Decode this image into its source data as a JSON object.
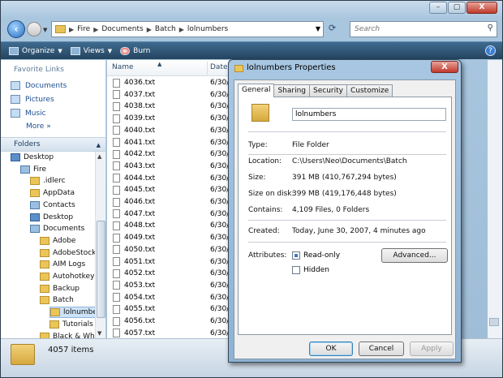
{
  "explorer": {
    "window_buttons": {
      "minimize": "–",
      "maximize": "▢",
      "close": "X"
    },
    "breadcrumbs": [
      "Fire",
      "Documents",
      "Batch",
      "lolnumbers"
    ],
    "search_placeholder": "Search",
    "toolbar": {
      "organize": "Organize",
      "views": "Views",
      "burn": "Burn"
    },
    "favorite_links_header": "Favorite Links",
    "favorites": [
      "Documents",
      "Pictures",
      "Music"
    ],
    "more_label": "More",
    "folders_header": "Folders",
    "tree": [
      {
        "label": "Desktop",
        "depth": 0,
        "icon": "desktop-icon"
      },
      {
        "label": "Fire",
        "depth": 1,
        "icon": "user-folder-icon"
      },
      {
        "label": ".idlerc",
        "depth": 2,
        "icon": "folder-icon"
      },
      {
        "label": "AppData",
        "depth": 2,
        "icon": "folder-icon"
      },
      {
        "label": "Contacts",
        "depth": 2,
        "icon": "contacts-icon"
      },
      {
        "label": "Desktop",
        "depth": 2,
        "icon": "desktop-icon"
      },
      {
        "label": "Documents",
        "depth": 2,
        "icon": "documents-icon"
      },
      {
        "label": "Adobe",
        "depth": 3,
        "icon": "folder-icon"
      },
      {
        "label": "AdobeStockPh",
        "depth": 3,
        "icon": "folder-icon"
      },
      {
        "label": "AIM Logs",
        "depth": 3,
        "icon": "folder-icon"
      },
      {
        "label": "Autohotkey",
        "depth": 3,
        "icon": "folder-icon"
      },
      {
        "label": "Backup",
        "depth": 3,
        "icon": "folder-icon"
      },
      {
        "label": "Batch",
        "depth": 3,
        "icon": "folder-icon"
      },
      {
        "label": "lolnumbers",
        "depth": 4,
        "icon": "folder-icon",
        "selected": true
      },
      {
        "label": "Tutorials",
        "depth": 4,
        "icon": "folder-icon"
      },
      {
        "label": "Black & White",
        "depth": 3,
        "icon": "folder-icon"
      }
    ],
    "columns": {
      "name": "Name",
      "date": "Date"
    },
    "files": [
      {
        "name": "4036.txt",
        "date": "6/30/"
      },
      {
        "name": "4037.txt",
        "date": "6/30/"
      },
      {
        "name": "4038.txt",
        "date": "6/30/"
      },
      {
        "name": "4039.txt",
        "date": "6/30/"
      },
      {
        "name": "4040.txt",
        "date": "6/30/"
      },
      {
        "name": "4041.txt",
        "date": "6/30/"
      },
      {
        "name": "4042.txt",
        "date": "6/30/"
      },
      {
        "name": "4043.txt",
        "date": "6/30/"
      },
      {
        "name": "4044.txt",
        "date": "6/30/"
      },
      {
        "name": "4045.txt",
        "date": "6/30/"
      },
      {
        "name": "4046.txt",
        "date": "6/30/"
      },
      {
        "name": "4047.txt",
        "date": "6/30/"
      },
      {
        "name": "4048.txt",
        "date": "6/30/"
      },
      {
        "name": "4049.txt",
        "date": "6/30/"
      },
      {
        "name": "4050.txt",
        "date": "6/30/"
      },
      {
        "name": "4051.txt",
        "date": "6/30/"
      },
      {
        "name": "4052.txt",
        "date": "6/30/"
      },
      {
        "name": "4053.txt",
        "date": "6/30/"
      },
      {
        "name": "4054.txt",
        "date": "6/30/"
      },
      {
        "name": "4055.txt",
        "date": "6/30/"
      },
      {
        "name": "4056.txt",
        "date": "6/30/"
      },
      {
        "name": "4057.txt",
        "date": "6/30/"
      }
    ],
    "item_count": "4057 items"
  },
  "dialog": {
    "title": "lolnumbers Properties",
    "close_label": "X",
    "tabs": [
      "General",
      "Sharing",
      "Security",
      "Customize"
    ],
    "active_tab": "General",
    "folder_name": "lolnumbers",
    "properties": [
      {
        "label": "Type:",
        "value": "File Folder"
      },
      {
        "label": "Location:",
        "value": "C:\\Users\\Neo\\Documents\\Batch"
      },
      {
        "label": "Size:",
        "value": "391 MB (410,767,294 bytes)"
      },
      {
        "label": "Size on disk:",
        "value": "399 MB (419,176,448 bytes)"
      },
      {
        "label": "Contains:",
        "value": "4,109 Files, 0 Folders"
      }
    ],
    "created_label": "Created:",
    "created_value": "Today, June 30, 2007, 4 minutes ago",
    "attributes_label": "Attributes:",
    "readonly_label": "Read-only",
    "hidden_label": "Hidden",
    "advanced_label": "Advanced...",
    "ok_label": "OK",
    "cancel_label": "Cancel",
    "apply_label": "Apply"
  }
}
